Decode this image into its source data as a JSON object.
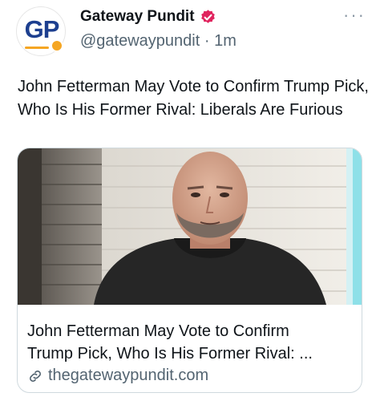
{
  "tweet": {
    "avatar_text": "GP",
    "display_name": "Gateway Pundit",
    "handle": "@gatewaypundit",
    "separator": "·",
    "time": "1m",
    "text": "John Fetterman May Vote to Confirm Trump Pick, Who Is His Former Rival: Liberals Are Furious",
    "more_label": "···"
  },
  "card": {
    "title_line1": "John Fetterman May Vote to Confirm",
    "title_line2": "Trump Pick, Who Is His Former Rival: ...",
    "domain": "thegatewaypundit.com"
  },
  "colors": {
    "verified": "#e0245e",
    "text": "#0f1419",
    "secondary": "#536471",
    "border": "#cfd9de",
    "avatar_brand": "#1d3f8f",
    "avatar_accent": "#f5a623"
  },
  "icons": {
    "verified": "verified-badge-icon",
    "more": "more-options-icon",
    "link": "link-icon"
  }
}
